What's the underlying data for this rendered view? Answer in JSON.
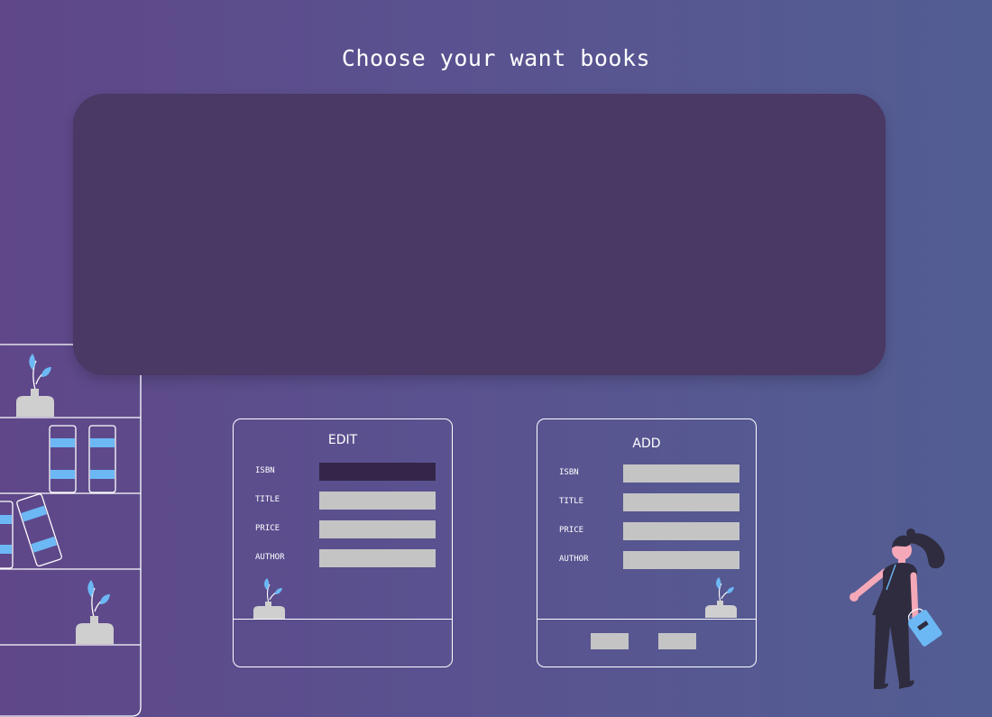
{
  "header": {
    "title": "Choose your want books"
  },
  "edit_form": {
    "title": "EDIT",
    "fields": [
      {
        "label": "ISBN",
        "value": ""
      },
      {
        "label": "TITLE",
        "value": ""
      },
      {
        "label": "PRICE",
        "value": ""
      },
      {
        "label": "AUTHOR",
        "value": ""
      }
    ]
  },
  "add_form": {
    "title": "ADD",
    "fields": [
      {
        "label": "ISBN",
        "value": ""
      },
      {
        "label": "TITLE",
        "value": ""
      },
      {
        "label": "PRICE",
        "value": ""
      },
      {
        "label": "AUTHOR",
        "value": ""
      }
    ],
    "buttons": [
      {
        "label": ""
      },
      {
        "label": ""
      }
    ]
  },
  "colors": {
    "background_start": "#5f4789",
    "background_end": "#525e93",
    "panel": "#4a3865",
    "input": "#c4c4c4",
    "input_focused": "#33264a",
    "accent": "#6cb8f5",
    "vase": "#cfcfcf"
  },
  "icons": [
    "bookshelf-illustration",
    "plant-vase-icon",
    "woman-with-book-illustration"
  ]
}
